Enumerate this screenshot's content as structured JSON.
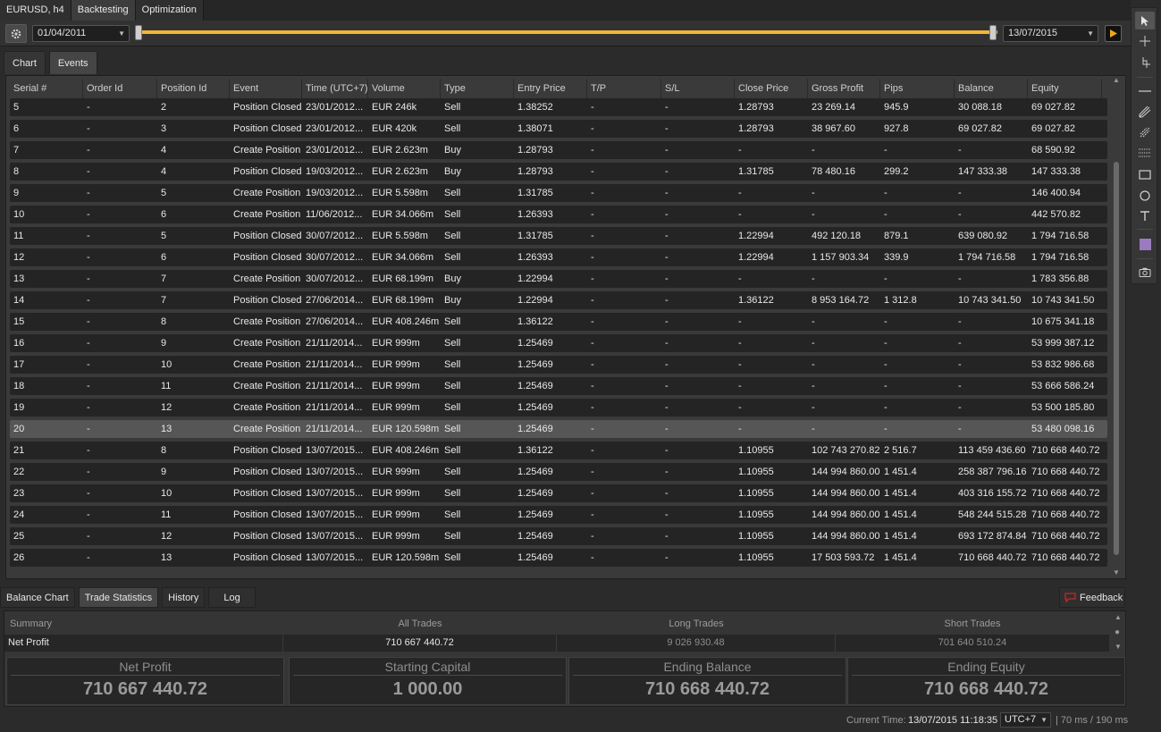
{
  "top_tabs": [
    "EURUSD, h4",
    "Backtesting",
    "Optimization"
  ],
  "toolbar": {
    "start_date": "01/04/2011",
    "end_date": "13/07/2015",
    "range_start_fraction": 0.0,
    "range_end_fraction": 1.0
  },
  "view_tabs": [
    "Chart",
    "Events"
  ],
  "events": {
    "columns": [
      "Serial #",
      "Order Id",
      "Position Id",
      "Event",
      "Time (UTC+7)",
      "Volume",
      "Type",
      "Entry Price",
      "T/P",
      "S/L",
      "Close Price",
      "Gross Profit",
      "Pips",
      "Balance",
      "Equity"
    ],
    "rows": [
      [
        "5",
        "-",
        "2",
        "Position Closed",
        "23/01/2012...",
        "EUR 246k",
        "Sell",
        "1.38252",
        "-",
        "-",
        "1.28793",
        "23 269.14",
        "945.9",
        "30 088.18",
        "69 027.82"
      ],
      [
        "6",
        "-",
        "3",
        "Position Closed",
        "23/01/2012...",
        "EUR 420k",
        "Sell",
        "1.38071",
        "-",
        "-",
        "1.28793",
        "38 967.60",
        "927.8",
        "69 027.82",
        "69 027.82"
      ],
      [
        "7",
        "-",
        "4",
        "Create Position",
        "23/01/2012...",
        "EUR 2.623m",
        "Buy",
        "1.28793",
        "-",
        "-",
        "-",
        "-",
        "-",
        "-",
        "68 590.92"
      ],
      [
        "8",
        "-",
        "4",
        "Position Closed",
        "19/03/2012...",
        "EUR 2.623m",
        "Buy",
        "1.28793",
        "-",
        "-",
        "1.31785",
        "78 480.16",
        "299.2",
        "147 333.38",
        "147 333.38"
      ],
      [
        "9",
        "-",
        "5",
        "Create Position",
        "19/03/2012...",
        "EUR 5.598m",
        "Sell",
        "1.31785",
        "-",
        "-",
        "-",
        "-",
        "-",
        "-",
        "146 400.94"
      ],
      [
        "10",
        "-",
        "6",
        "Create Position",
        "11/06/2012...",
        "EUR 34.066m",
        "Sell",
        "1.26393",
        "-",
        "-",
        "-",
        "-",
        "-",
        "-",
        "442 570.82"
      ],
      [
        "11",
        "-",
        "5",
        "Position Closed",
        "30/07/2012...",
        "EUR 5.598m",
        "Sell",
        "1.31785",
        "-",
        "-",
        "1.22994",
        "492 120.18",
        "879.1",
        "639 080.92",
        "1 794 716.58"
      ],
      [
        "12",
        "-",
        "6",
        "Position Closed",
        "30/07/2012...",
        "EUR 34.066m",
        "Sell",
        "1.26393",
        "-",
        "-",
        "1.22994",
        "1 157 903.34",
        "339.9",
        "1 794 716.58",
        "1 794 716.58"
      ],
      [
        "13",
        "-",
        "7",
        "Create Position",
        "30/07/2012...",
        "EUR 68.199m",
        "Buy",
        "1.22994",
        "-",
        "-",
        "-",
        "-",
        "-",
        "-",
        "1 783 356.88"
      ],
      [
        "14",
        "-",
        "7",
        "Position Closed",
        "27/06/2014...",
        "EUR 68.199m",
        "Buy",
        "1.22994",
        "-",
        "-",
        "1.36122",
        "8 953 164.72",
        "1 312.8",
        "10 743 341.50",
        "10 743 341.50"
      ],
      [
        "15",
        "-",
        "8",
        "Create Position",
        "27/06/2014...",
        "EUR 408.246m",
        "Sell",
        "1.36122",
        "-",
        "-",
        "-",
        "-",
        "-",
        "-",
        "10 675 341.18"
      ],
      [
        "16",
        "-",
        "9",
        "Create Position",
        "21/11/2014...",
        "EUR 999m",
        "Sell",
        "1.25469",
        "-",
        "-",
        "-",
        "-",
        "-",
        "-",
        "53 999 387.12"
      ],
      [
        "17",
        "-",
        "10",
        "Create Position",
        "21/11/2014...",
        "EUR 999m",
        "Sell",
        "1.25469",
        "-",
        "-",
        "-",
        "-",
        "-",
        "-",
        "53 832 986.68"
      ],
      [
        "18",
        "-",
        "11",
        "Create Position",
        "21/11/2014...",
        "EUR 999m",
        "Sell",
        "1.25469",
        "-",
        "-",
        "-",
        "-",
        "-",
        "-",
        "53 666 586.24"
      ],
      [
        "19",
        "-",
        "12",
        "Create Position",
        "21/11/2014...",
        "EUR 999m",
        "Sell",
        "1.25469",
        "-",
        "-",
        "-",
        "-",
        "-",
        "-",
        "53 500 185.80"
      ],
      [
        "20",
        "-",
        "13",
        "Create Position",
        "21/11/2014...",
        "EUR 120.598m",
        "Sell",
        "1.25469",
        "-",
        "-",
        "-",
        "-",
        "-",
        "-",
        "53 480 098.16"
      ],
      [
        "21",
        "-",
        "8",
        "Position Closed",
        "13/07/2015...",
        "EUR 408.246m",
        "Sell",
        "1.36122",
        "-",
        "-",
        "1.10955",
        "102 743 270.82",
        "2 516.7",
        "113 459 436.60",
        "710 668 440.72"
      ],
      [
        "22",
        "-",
        "9",
        "Position Closed",
        "13/07/2015...",
        "EUR 999m",
        "Sell",
        "1.25469",
        "-",
        "-",
        "1.10955",
        "144 994 860.00",
        "1 451.4",
        "258 387 796.16",
        "710 668 440.72"
      ],
      [
        "23",
        "-",
        "10",
        "Position Closed",
        "13/07/2015...",
        "EUR 999m",
        "Sell",
        "1.25469",
        "-",
        "-",
        "1.10955",
        "144 994 860.00",
        "1 451.4",
        "403 316 155.72",
        "710 668 440.72"
      ],
      [
        "24",
        "-",
        "11",
        "Position Closed",
        "13/07/2015...",
        "EUR 999m",
        "Sell",
        "1.25469",
        "-",
        "-",
        "1.10955",
        "144 994 860.00",
        "1 451.4",
        "548 244 515.28",
        "710 668 440.72"
      ],
      [
        "25",
        "-",
        "12",
        "Position Closed",
        "13/07/2015...",
        "EUR 999m",
        "Sell",
        "1.25469",
        "-",
        "-",
        "1.10955",
        "144 994 860.00",
        "1 451.4",
        "693 172 874.84",
        "710 668 440.72"
      ],
      [
        "26",
        "-",
        "13",
        "Position Closed",
        "13/07/2015...",
        "EUR 120.598m",
        "Sell",
        "1.25469",
        "-",
        "-",
        "1.10955",
        "17 503 593.72",
        "1 451.4",
        "710 668 440.72",
        "710 668 440.72"
      ]
    ],
    "selected_serial": "20"
  },
  "bottom_tabs": [
    "Balance Chart",
    "Trade Statistics",
    "History",
    "Log"
  ],
  "feedback_label": "Feedback",
  "stats": {
    "headers": [
      "Summary",
      "All Trades",
      "Long Trades",
      "Short Trades"
    ],
    "row": [
      "Net Profit",
      "710 667 440.72",
      "9 026 930.48",
      "701 640 510.24"
    ]
  },
  "kpis": [
    {
      "label": "Net Profit",
      "value": "710 667 440.72"
    },
    {
      "label": "Starting Capital",
      "value": "1 000.00"
    },
    {
      "label": "Ending Balance",
      "value": "710 668 440.72"
    },
    {
      "label": "Ending Equity",
      "value": "710 668 440.72"
    }
  ],
  "status": {
    "label": "Current Time:",
    "time": "13/07/2015 11:18:35",
    "timezone": "UTC+7",
    "latency": "| 70 ms / 190 ms"
  },
  "colors": {
    "accent_slider": "#f2b534",
    "play_icon": "#f2a51c",
    "feedback_icon": "#c62828",
    "swatch": "#9a7bbf"
  },
  "icons": {
    "gear": "gear-icon",
    "play": "play-icon",
    "right_tools": [
      "cursor-icon",
      "crosshair-icon",
      "zoom-icon",
      "horizontal-line-icon",
      "andrews-pitchfork-icon",
      "fibonacci-icon",
      "grid-icon",
      "rectangle-icon",
      "ellipse-icon",
      "text-icon",
      "color-swatch-icon",
      "screenshot-icon"
    ]
  }
}
